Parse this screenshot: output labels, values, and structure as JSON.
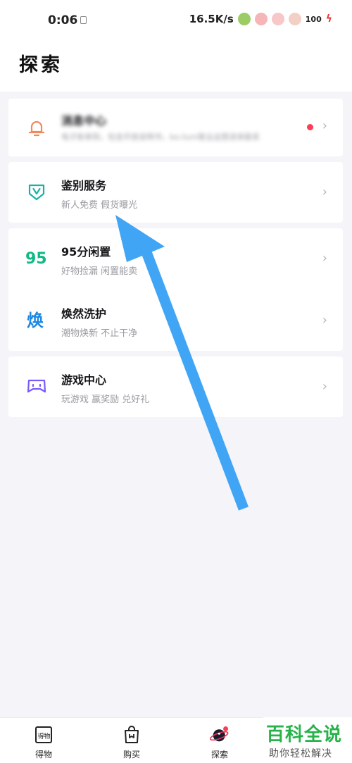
{
  "status_bar": {
    "time": "0:06",
    "net_speed": "16.5K/s",
    "battery": "100"
  },
  "header": {
    "title": "探索"
  },
  "items": [
    {
      "title": "消息中心",
      "subtitle": "电子账单到，包含开放说明书，bo.liuni客业运营进来联系",
      "icon": "bell-icon",
      "color": "#f08a5d"
    },
    {
      "title": "鉴别服务",
      "subtitle": "新人免费 假货曝光",
      "icon": "shield-v-icon",
      "color": "#1ab1a7"
    },
    {
      "title": "95分闲置",
      "subtitle": "好物捡漏 闲置能卖",
      "icon": "95-logo-icon",
      "color": "#12b886"
    },
    {
      "title": "焕然洗护",
      "subtitle": "潮物焕新 不止干净",
      "icon": "huan-logo-icon",
      "color": "#1e88e5"
    },
    {
      "title": "游戏中心",
      "subtitle": "玩游戏 赢奖励 兑好礼",
      "icon": "gamepad-icon",
      "color": "#7a5af8"
    }
  ],
  "tabbar": {
    "tabs": [
      {
        "label": "得物",
        "icon": "dewu-logo-icon"
      },
      {
        "label": "购买",
        "icon": "shopping-bag-icon"
      },
      {
        "label": "探索",
        "icon": "planet-icon"
      }
    ]
  },
  "watermark": {
    "title": "百科全说",
    "subtitle": "助你轻松解决"
  },
  "colors": {
    "accent": "#41a5f5",
    "background": "#f5f5f9"
  }
}
